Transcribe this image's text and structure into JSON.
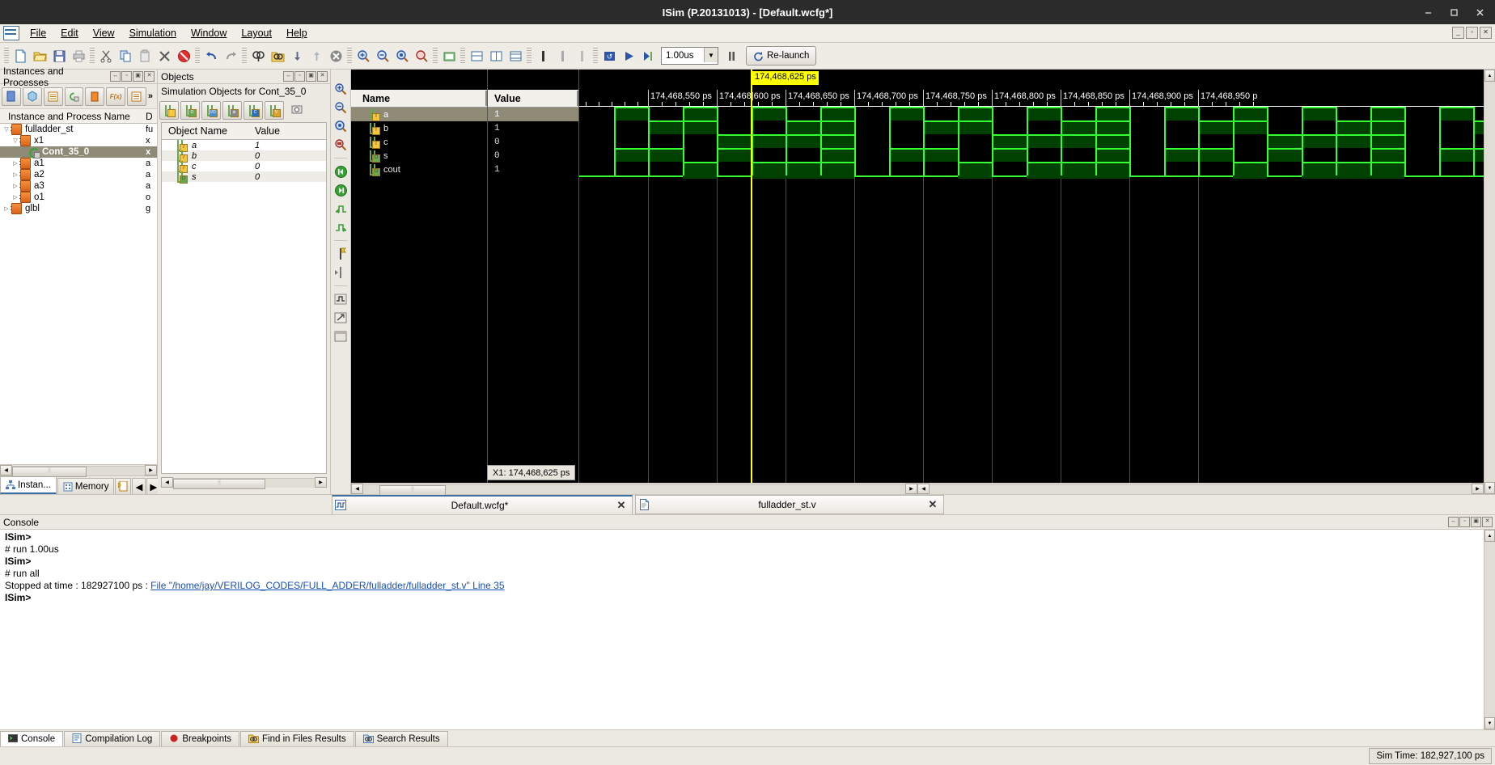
{
  "window": {
    "title": "ISim (P.20131013) - [Default.wcfg*]",
    "minimize": "—",
    "maximize": "▢",
    "close": "✕"
  },
  "menubar": {
    "items": [
      "File",
      "Edit",
      "View",
      "Simulation",
      "Window",
      "Layout",
      "Help"
    ],
    "mdi_buttons": [
      "_",
      "▫",
      "✕"
    ]
  },
  "toolbar": {
    "icons": [
      "new-file-icon",
      "open-folder-icon",
      "save-icon",
      "print-icon",
      "cut-icon",
      "copy-icon",
      "paste-icon",
      "delete-icon",
      "cancel-icon",
      "undo-icon",
      "redo-icon",
      "find-icon",
      "find-in-files-icon",
      "down-arrow-icon",
      "up-arrow-icon",
      "remove-icon",
      "properties-icon",
      "zoom-in-icon",
      "zoom-out-icon",
      "zoom-fit-icon",
      "zoom-cursor-icon",
      "snapshot-icon",
      "wave-add-icon",
      "wave-divider-icon",
      "marker-icon",
      "marker-prev-icon",
      "marker-next-icon",
      "restart-icon",
      "run-icon",
      "run-for-icon",
      "pause-icon"
    ],
    "run_time_value": "1.00us",
    "relaunch_label": "Re-launch"
  },
  "instances_panel": {
    "title": "Instances and Processes",
    "header": "Instance and Process Name",
    "col2_header": "D",
    "toolbar_icons": [
      "show-instances-icon",
      "show-packages-icon",
      "show-processes-icon",
      "show-generate-icon",
      "show-modules-icon",
      "show-functions-icon",
      "show-blocks-icon"
    ],
    "more_label": "»",
    "tree": [
      {
        "label": "fulladder_st",
        "col2": "fu",
        "indent": 0,
        "twisty": "▽",
        "icon": "chip-icon",
        "selected": false
      },
      {
        "label": "x1",
        "col2": "x",
        "indent": 1,
        "twisty": "▽",
        "icon": "chip-icon",
        "selected": false
      },
      {
        "label": "Cont_35_0",
        "col2": "x",
        "indent": 2,
        "twisty": "",
        "icon": "process-icon",
        "selected": true
      },
      {
        "label": "a1",
        "col2": "a",
        "indent": 1,
        "twisty": "▷",
        "icon": "chip-icon",
        "selected": false
      },
      {
        "label": "a2",
        "col2": "a",
        "indent": 1,
        "twisty": "▷",
        "icon": "chip-icon",
        "selected": false
      },
      {
        "label": "a3",
        "col2": "a",
        "indent": 1,
        "twisty": "▷",
        "icon": "chip-icon",
        "selected": false
      },
      {
        "label": "o1",
        "col2": "o",
        "indent": 1,
        "twisty": "▷",
        "icon": "chip-icon",
        "selected": false
      },
      {
        "label": "glbl",
        "col2": "g",
        "indent": 0,
        "twisty": "▷",
        "icon": "chip-icon",
        "selected": false
      }
    ],
    "tabs": [
      {
        "label": "Instan...",
        "icon": "hierarchy-icon",
        "active": true
      },
      {
        "label": "Memory",
        "icon": "memory-icon",
        "active": false
      }
    ]
  },
  "objects_panel": {
    "title": "Objects",
    "subtitle": "Simulation Objects for Cont_35_0",
    "filter_icons": [
      "input-filter-icon",
      "output-filter-icon",
      "inout-filter-icon",
      "internal-filter-icon",
      "constant-filter-icon",
      "variable-filter-icon",
      "settings-icon"
    ],
    "columns": [
      "Object Name",
      "Value"
    ],
    "rows": [
      {
        "name": "a",
        "value": "1",
        "kind": "input"
      },
      {
        "name": "b",
        "value": "0",
        "kind": "input"
      },
      {
        "name": "c",
        "value": "0",
        "kind": "input"
      },
      {
        "name": "s",
        "value": "0",
        "kind": "output"
      }
    ]
  },
  "wave_panel": {
    "columns": [
      "Name",
      "Value"
    ],
    "tool_icons": [
      "zoom-in-icon",
      "zoom-out-icon",
      "zoom-fit-icon",
      "zoom-to-cursor-icon",
      "go-to-start-icon",
      "go-to-end-icon",
      "prev-transition-icon",
      "next-transition-icon",
      "add-marker-icon",
      "prev-marker-icon",
      "next-marker-icon",
      "snap-to-transition-icon",
      "float-icon",
      "dock-icon"
    ],
    "signals": [
      {
        "name": "a",
        "value": "1",
        "kind": "input",
        "selected": true
      },
      {
        "name": "b",
        "value": "1",
        "kind": "input",
        "selected": false
      },
      {
        "name": "c",
        "value": "0",
        "kind": "input",
        "selected": false
      },
      {
        "name": "s",
        "value": "0",
        "kind": "output",
        "selected": false
      },
      {
        "name": "cout",
        "value": "1",
        "kind": "output",
        "selected": false
      }
    ],
    "cursor": {
      "flag_label": "174,468,625 ps",
      "x1_label": "X1: 174,468,625 ps",
      "color": "#ffff00"
    },
    "ruler_labels": [
      "174,468,550 ps",
      "174,468|600 ps",
      "174,468,650 ps",
      "174,468,700 ps",
      "174,468,750 ps",
      "174,468,800 ps",
      "174,468,850 ps",
      "174,468,900 ps",
      "174,468,950 p"
    ]
  },
  "file_tabs": [
    {
      "label": "Default.wcfg*",
      "icon": "wave-file-icon",
      "active": true,
      "close": "✕"
    },
    {
      "label": "fulladder_st.v",
      "icon": "verilog-file-icon",
      "active": false,
      "close": "✕"
    }
  ],
  "console": {
    "title": "Console",
    "lines": [
      {
        "text": "ISim>",
        "bold": true
      },
      {
        "text": "# run 1.00us",
        "bold": false
      },
      {
        "text": "ISim>",
        "bold": true
      },
      {
        "text": "# run all",
        "bold": false
      },
      {
        "prefix": "Stopped at time : 182927100 ps : ",
        "link": "File \"/home/jay/VERILOG_CODES/FULL_ADDER/fulladder/fulladder_st.v\" Line 35",
        "bold": false
      },
      {
        "text": "ISim>",
        "bold": true
      }
    ],
    "tabs": [
      {
        "label": "Console",
        "icon": "console-icon",
        "active": true
      },
      {
        "label": "Compilation Log",
        "icon": "log-icon",
        "active": false
      },
      {
        "label": "Breakpoints",
        "icon": "breakpoint-icon",
        "active": false
      },
      {
        "label": "Find in Files Results",
        "icon": "find-files-icon",
        "active": false
      },
      {
        "label": "Search Results",
        "icon": "search-icon",
        "active": false
      }
    ]
  },
  "statusbar": {
    "sim_time": "Sim Time: 182,927,100 ps"
  }
}
